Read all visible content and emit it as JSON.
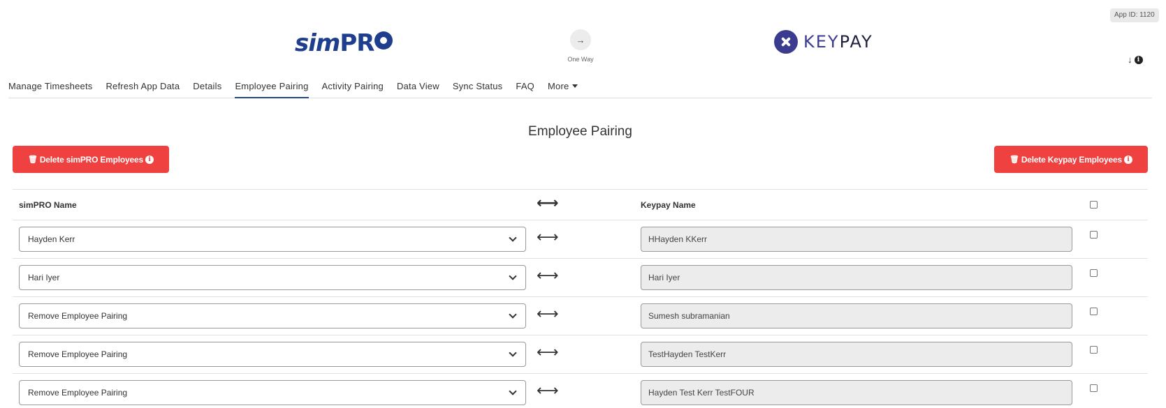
{
  "app_id": "App ID: 1120",
  "header": {
    "left_logo": {
      "text_main": "sim",
      "text_pro": "PR"
    },
    "right_logo": {
      "text_key": "KEY",
      "text_pay": "PAY"
    },
    "sync_direction": {
      "label": "One Way",
      "icon": "arrow-right-icon"
    }
  },
  "nav": {
    "tabs": [
      {
        "label": "Manage Timesheets"
      },
      {
        "label": "Refresh App Data"
      },
      {
        "label": "Details"
      },
      {
        "label": "Employee Pairing",
        "active": true
      },
      {
        "label": "Activity Pairing"
      },
      {
        "label": "Data View"
      },
      {
        "label": "Sync Status"
      },
      {
        "label": "FAQ"
      },
      {
        "label": "More"
      }
    ]
  },
  "page": {
    "title": "Employee Pairing",
    "delete_simpro_label": "Delete simPRO Employees",
    "delete_keypay_label": "Delete Keypay Employees"
  },
  "table": {
    "headers": {
      "simpro": "simPRO Name",
      "keypay": "Keypay Name"
    },
    "rows": [
      {
        "simpro": "Hayden Kerr",
        "keypay": "HHayden KKerr"
      },
      {
        "simpro": "Hari Iyer",
        "keypay": "Hari Iyer"
      },
      {
        "simpro": "Remove Employee Pairing",
        "keypay": "Sumesh subramanian"
      },
      {
        "simpro": "Remove Employee Pairing",
        "keypay": "TestHayden TestKerr"
      },
      {
        "simpro": "Remove Employee Pairing",
        "keypay": "Hayden Test Kerr TestFOUR"
      }
    ]
  },
  "colors": {
    "danger": "#f04141",
    "active_tab": "#1f4a8a",
    "simpro_brand": "#1f3f8e",
    "keypay_brand": "#3b3b8f"
  }
}
